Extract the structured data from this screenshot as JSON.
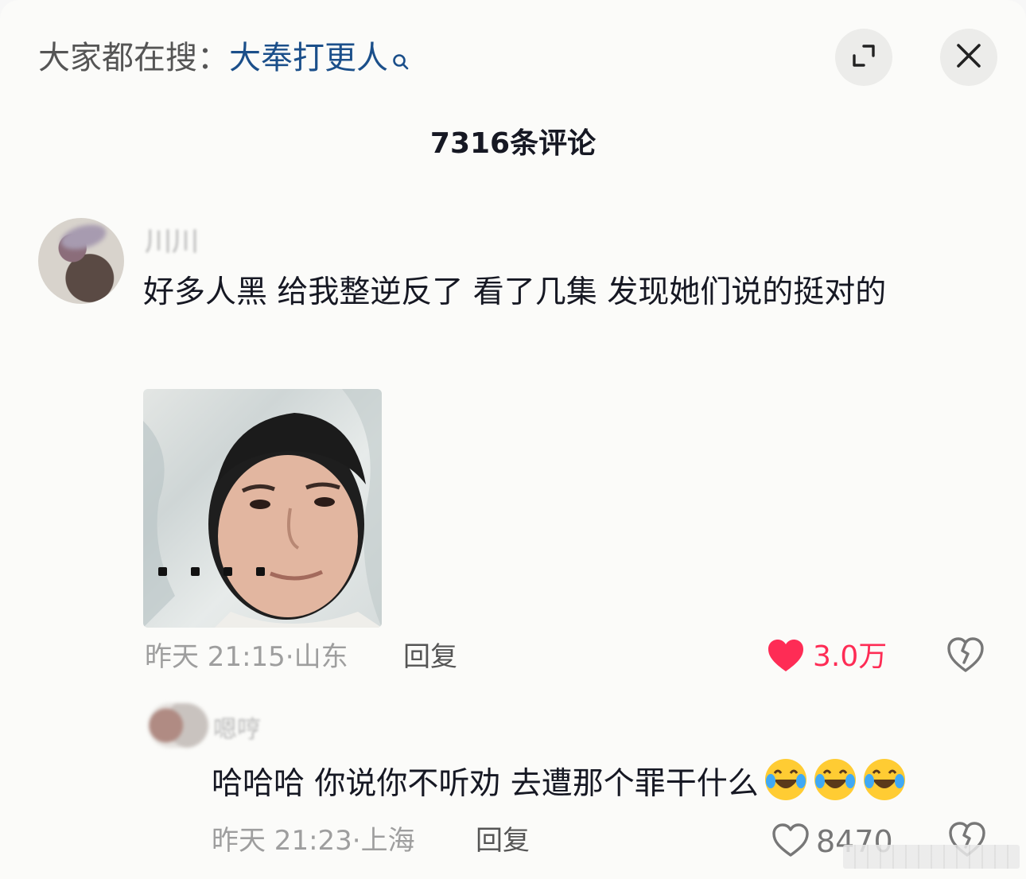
{
  "header": {
    "search_prefix": "大家都在搜：",
    "search_keyword": "大奉打更人",
    "search_icon": "search-icon",
    "expand_icon": "expand-icon",
    "close_icon": "close-icon"
  },
  "comment_count": "7316条评论",
  "comments": [
    {
      "username": "川川",
      "text": "好多人黑  给我整逆反了  看了几集  发现她们说的挺对的",
      "time": "昨天 21:15",
      "location": "山东",
      "reply_label": "回复",
      "likes": "3.0万",
      "liked": true,
      "image": "meme-image",
      "image_caption": "...."
    }
  ],
  "replies": [
    {
      "username": "嗯哼",
      "text": "哈哈哈 你说你不听劝 去遭那个罪干什么",
      "emojis": [
        "laugh-cry-emoji",
        "laugh-cry-emoji",
        "laugh-cry-emoji"
      ],
      "time": "昨天 21:23",
      "location": "上海",
      "reply_label": "回复",
      "likes": "8470",
      "liked": false
    }
  ],
  "colors": {
    "keyword": "#1b4f8a",
    "like_active": "#fe2c55",
    "muted_text": "#9e9e9e"
  }
}
